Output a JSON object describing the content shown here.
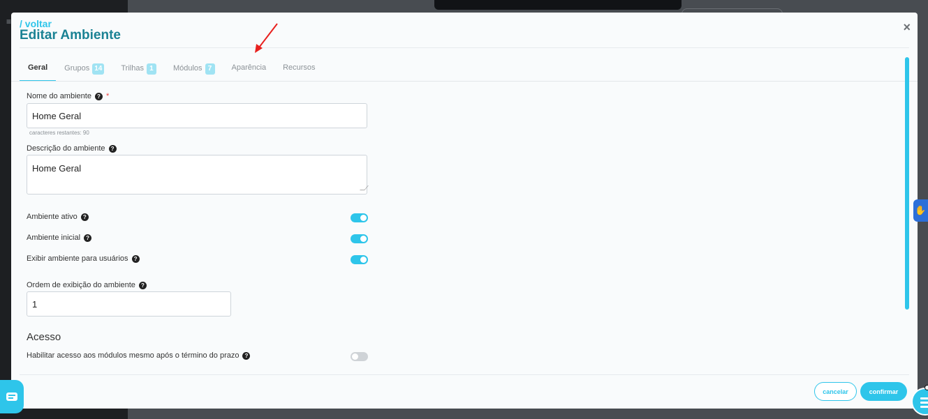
{
  "modal": {
    "back_link": "/ voltar",
    "title": "Editar Ambiente"
  },
  "tabs": [
    {
      "label": "Geral",
      "badge": null,
      "active": true
    },
    {
      "label": "Grupos",
      "badge": "14"
    },
    {
      "label": "Trilhas",
      "badge": "1"
    },
    {
      "label": "Módulos",
      "badge": "7"
    },
    {
      "label": "Aparência",
      "badge": null
    },
    {
      "label": "Recursos",
      "badge": null
    }
  ],
  "form": {
    "name": {
      "label": "Nome do ambiente",
      "required_mark": "*",
      "value": "Home Geral",
      "hint": "caracteres restantes: 90"
    },
    "description": {
      "label": "Descrição do ambiente",
      "value": "Home Geral"
    },
    "toggles": [
      {
        "label": "Ambiente ativo",
        "on": true
      },
      {
        "label": "Ambiente inicial",
        "on": true
      },
      {
        "label": "Exibir ambiente para usuários",
        "on": true
      }
    ],
    "order": {
      "label": "Ordem de exibição do ambiente",
      "value": "1"
    }
  },
  "access": {
    "title": "Acesso",
    "toggle": {
      "label": "Habilitar acesso aos módulos mesmo após o término do prazo",
      "on": false
    }
  },
  "footer": {
    "cancel_label": "cancelar",
    "confirm_label": "confirmar"
  },
  "icons": {
    "help": "?",
    "close": "×",
    "a11y": "✋"
  },
  "colors": {
    "accent": "#2ec5ea",
    "title": "#1a8294",
    "arrow": "#e8201e"
  }
}
